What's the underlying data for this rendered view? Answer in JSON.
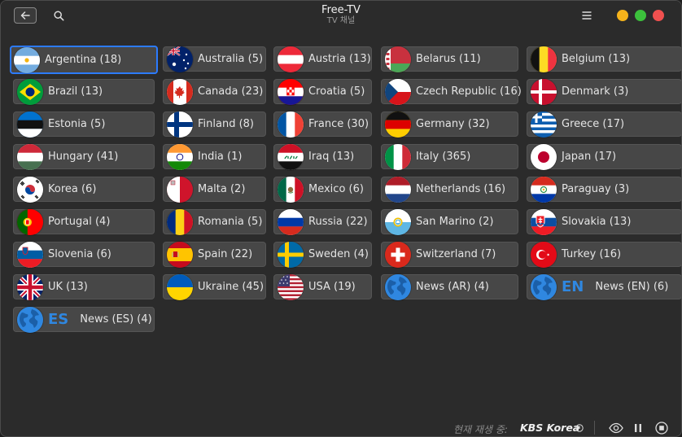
{
  "header": {
    "title": "Free-TV",
    "subtitle": "TV 채널"
  },
  "footer": {
    "now_playing_label": "현재 재생 중:",
    "now_playing_value": "KBS Korea"
  },
  "colors": {
    "accent": "#2c7bff",
    "tile_bg": "#474747",
    "window_bg": "#2b2b2b",
    "news_code": "#2f87e0"
  },
  "channels": [
    {
      "label": "Argentina (18)",
      "flag": "argentina"
    },
    {
      "label": "Australia (5)",
      "flag": "australia"
    },
    {
      "label": "Austria (13)",
      "flag": "austria"
    },
    {
      "label": "Belarus (11)",
      "flag": "belarus"
    },
    {
      "label": "Belgium (13)",
      "flag": "belgium"
    },
    {
      "label": "Brazil (13)",
      "flag": "brazil"
    },
    {
      "label": "Canada (23)",
      "flag": "canada"
    },
    {
      "label": "Croatia (5)",
      "flag": "croatia"
    },
    {
      "label": "Czech Republic (16)",
      "flag": "czech"
    },
    {
      "label": "Denmark (3)",
      "flag": "denmark"
    },
    {
      "label": "Estonia (5)",
      "flag": "estonia"
    },
    {
      "label": "Finland (8)",
      "flag": "finland"
    },
    {
      "label": "France (30)",
      "flag": "france"
    },
    {
      "label": "Germany (32)",
      "flag": "germany"
    },
    {
      "label": "Greece (17)",
      "flag": "greece"
    },
    {
      "label": "Hungary (41)",
      "flag": "hungary"
    },
    {
      "label": "India (1)",
      "flag": "india"
    },
    {
      "label": "Iraq (13)",
      "flag": "iraq"
    },
    {
      "label": "Italy (365)",
      "flag": "italy"
    },
    {
      "label": "Japan (17)",
      "flag": "japan"
    },
    {
      "label": "Korea (6)",
      "flag": "korea"
    },
    {
      "label": "Malta (2)",
      "flag": "malta"
    },
    {
      "label": "Mexico (6)",
      "flag": "mexico"
    },
    {
      "label": "Netherlands (16)",
      "flag": "netherlands"
    },
    {
      "label": "Paraguay (3)",
      "flag": "paraguay"
    },
    {
      "label": "Portugal (4)",
      "flag": "portugal"
    },
    {
      "label": "Romania (5)",
      "flag": "romania"
    },
    {
      "label": "Russia (22)",
      "flag": "russia"
    },
    {
      "label": "San Marino (2)",
      "flag": "sanmarino"
    },
    {
      "label": "Slovakia (13)",
      "flag": "slovakia"
    },
    {
      "label": "Slovenia (6)",
      "flag": "slovenia"
    },
    {
      "label": "Spain (22)",
      "flag": "spain"
    },
    {
      "label": "Sweden (4)",
      "flag": "sweden"
    },
    {
      "label": "Switzerland (7)",
      "flag": "switzerland"
    },
    {
      "label": "Turkey (16)",
      "flag": "turkey"
    },
    {
      "label": "UK (13)",
      "flag": "uk"
    },
    {
      "label": "Ukraine (45)",
      "flag": "ukraine"
    },
    {
      "label": "USA (19)",
      "flag": "usa"
    },
    {
      "label": "News (AR) (4)",
      "flag": "globe"
    },
    {
      "label": "News (EN) (6)",
      "flag": "globe",
      "code": "EN"
    },
    {
      "label": "News (ES) (4)",
      "flag": "globe",
      "code": "ES"
    }
  ]
}
